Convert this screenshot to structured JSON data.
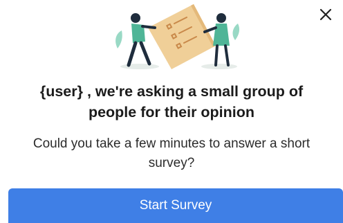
{
  "dialog": {
    "close_icon": "close-icon",
    "illustration_icon": "survey-people-illustration",
    "headline_line1": "{user} , we're asking a small group of",
    "headline_line2": "people for their opinion",
    "body_line1": "Could you take a few minutes to answer a short",
    "body_line2": "survey?",
    "button_label": "Start Survey"
  },
  "colors": {
    "accent": "#3f7fe6",
    "paper": "#f0cf98",
    "teal_figure": "#4fb597",
    "dark_figure": "#1f2d3d"
  }
}
